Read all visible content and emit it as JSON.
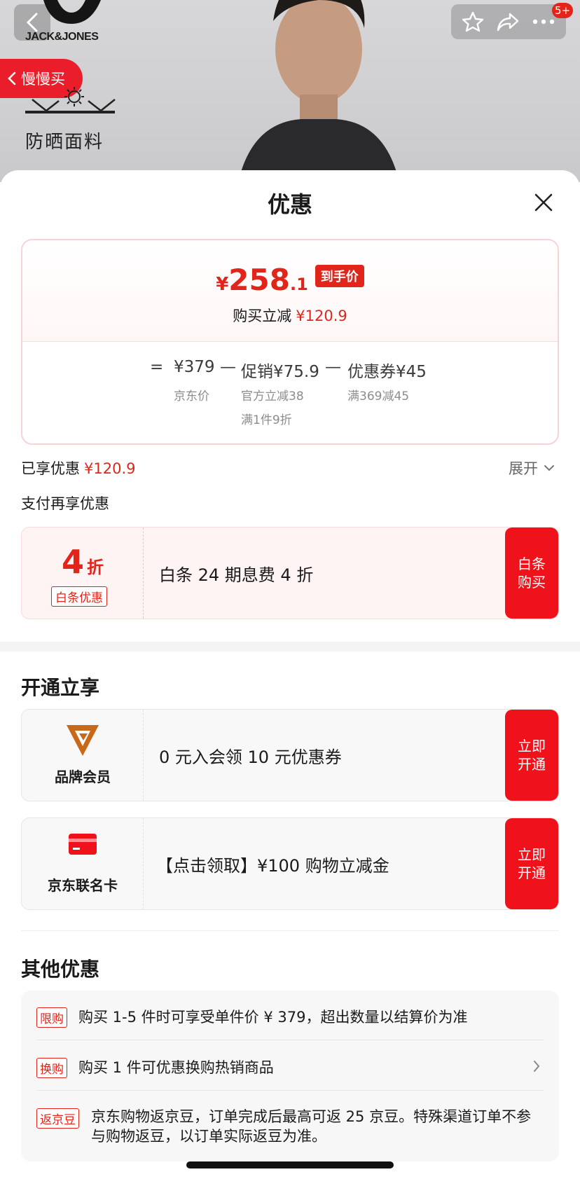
{
  "hero": {
    "brand_text": "JACK&JONES",
    "slow_buy_label": "慢慢买",
    "feature_text": "防晒面料",
    "cart_badge": "5+",
    "icons": [
      "back-icon",
      "star-icon",
      "share-icon",
      "more-icon"
    ]
  },
  "sheet": {
    "title": "优惠"
  },
  "price_card": {
    "yen": "¥",
    "final_int": "258",
    "final_dec": ".1",
    "price_tag": "到手价",
    "instant_cut_label": "购买立减",
    "instant_cut_value": "¥120.9",
    "eq": "=",
    "base_price": "¥379",
    "base_price_label": "京东价",
    "minus1": "—",
    "promo": "促销¥75.9",
    "promo_sub1": "官方立减38",
    "promo_sub2": "满1件9折",
    "minus2": "—",
    "coupon": "优惠券¥45",
    "coupon_sub": "满369减45"
  },
  "summary": {
    "enjoyed_label": "已享优惠",
    "enjoyed_value": "¥120.9",
    "expand_label": "展开",
    "pay_more_label": "支付再享优惠"
  },
  "baitiao": {
    "discount_num": "4",
    "discount_unit": "折",
    "tag": "白条优惠",
    "text": "白条 24 期息费 4 折",
    "button": "白条\n购买"
  },
  "open_section": {
    "title": "开通立享",
    "offers": [
      {
        "caption": "品牌会员",
        "text": "0 元入会领 10 元优惠券",
        "button": "立即\n开通"
      },
      {
        "caption": "京东联名卡",
        "text": "【点击领取】¥100 购物立减金",
        "button": "立即\n开通"
      }
    ]
  },
  "other_section": {
    "title": "其他优惠",
    "rows": [
      {
        "tag": "限购",
        "text": "购买 1-5 件时可享受单件价 ¥ 379，超出数量以结算价为准"
      },
      {
        "tag": "换购",
        "text": "购买 1 件可优惠换购热销商品"
      },
      {
        "tag": "返京豆",
        "text": "京东购物返京豆，订单完成后最高可返 25 京豆。特殊渠道订单不参与购物返豆，以订单实际返豆为准。"
      }
    ]
  },
  "colors": {
    "accent_red": "#e1251b",
    "button_red": "#f0121b",
    "member_orange": "#c8691a"
  }
}
